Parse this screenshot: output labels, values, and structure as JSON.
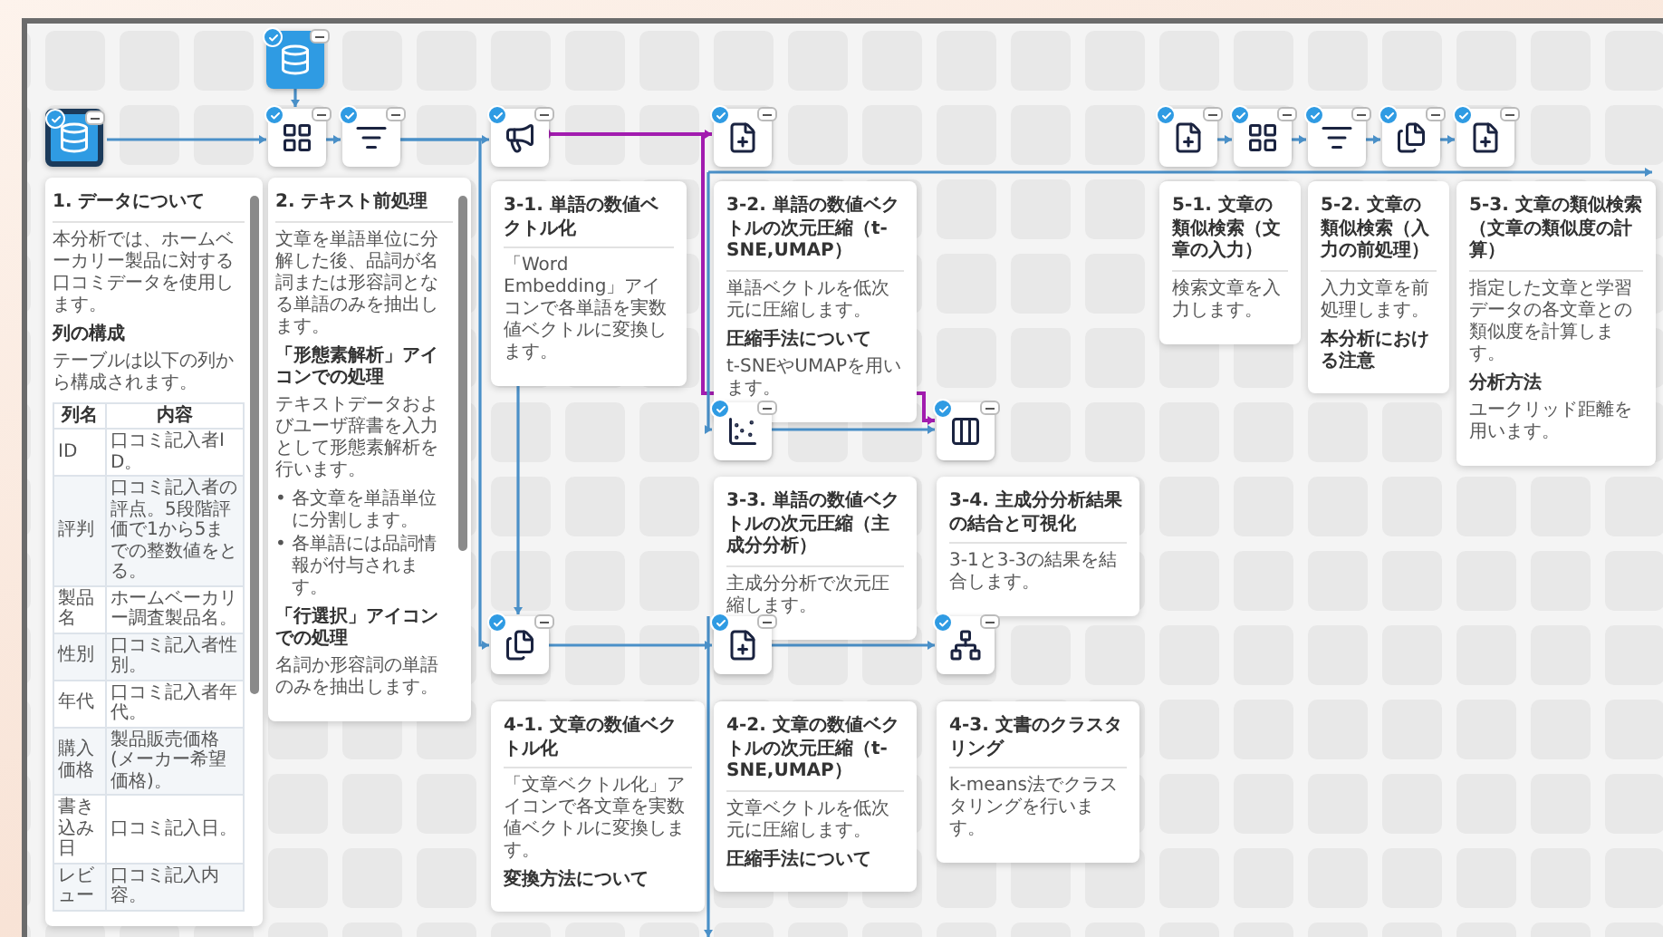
{
  "nodes": [
    {
      "kind": "database",
      "source": true,
      "selected": false,
      "checked": true
    },
    {
      "kind": "database",
      "source": true,
      "selected": true,
      "checked": true
    },
    {
      "kind": "grid",
      "source": false,
      "selected": false,
      "checked": true
    },
    {
      "kind": "filter",
      "source": false,
      "selected": false,
      "checked": true
    },
    {
      "kind": "speaker",
      "source": false,
      "selected": false,
      "checked": true
    },
    {
      "kind": "doc",
      "source": false,
      "selected": false,
      "checked": true
    },
    {
      "kind": "doc",
      "source": false,
      "selected": false,
      "checked": true
    },
    {
      "kind": "grid",
      "source": false,
      "selected": false,
      "checked": true
    },
    {
      "kind": "filter",
      "source": false,
      "selected": false,
      "checked": true
    },
    {
      "kind": "pages",
      "source": false,
      "selected": false,
      "checked": true
    },
    {
      "kind": "doc",
      "source": false,
      "selected": false,
      "checked": true
    },
    {
      "kind": "scatter",
      "source": false,
      "selected": false,
      "checked": true
    },
    {
      "kind": "columns",
      "source": false,
      "selected": false,
      "checked": true
    },
    {
      "kind": "pages",
      "source": false,
      "selected": false,
      "checked": true
    },
    {
      "kind": "doc",
      "source": false,
      "selected": false,
      "checked": true
    },
    {
      "kind": "network",
      "source": false,
      "selected": false,
      "checked": true
    }
  ],
  "edges": [
    {
      "selected": false
    },
    {
      "selected": false
    },
    {
      "selected": false
    },
    {
      "selected": false
    },
    {
      "selected": false
    },
    {
      "selected": true
    },
    {
      "selected": true
    },
    {
      "selected": false
    },
    {
      "selected": false
    },
    {
      "selected": false
    },
    {
      "selected": false
    },
    {
      "selected": false
    },
    {
      "selected": false
    },
    {
      "selected": false
    },
    {
      "selected": false
    },
    {
      "selected": false
    },
    {
      "selected": false
    },
    {
      "selected": false
    }
  ],
  "cards": [
    {
      "title": "1. データについて",
      "scrollable": true,
      "blocks": [
        {
          "kind": "p",
          "text": "本分析では、ホームベーカリー製品に対する口コミデータを使用します。"
        },
        {
          "kind": "h",
          "text": "列の構成"
        },
        {
          "kind": "p",
          "text": "テーブルは以下の列から構成されます。"
        },
        {
          "kind": "table",
          "columns": [
            "列名",
            "内容"
          ],
          "rows": [
            [
              "ID",
              "口コミ記入者ID。"
            ],
            [
              "評判",
              "口コミ記入者の評点。5段階評価で1から5までの整数値をとる。"
            ],
            [
              "製品名",
              "ホームベーカリー調査製品名。"
            ],
            [
              "性別",
              "口コミ記入者性別。"
            ],
            [
              "年代",
              "口コミ記入者年代。"
            ],
            [
              "購入価格",
              "製品販売価格(メーカー希望価格)。"
            ],
            [
              "書き込み日",
              "口コミ記入日。"
            ],
            [
              "レビュー",
              "口コミ記入内容。"
            ]
          ]
        }
      ]
    },
    {
      "title": "2. テキスト前処理",
      "scrollable": true,
      "blocks": [
        {
          "kind": "p",
          "text": "文章を単語単位に分解した後、品詞が名詞または形容詞となる単語のみを抽出します。"
        },
        {
          "kind": "h",
          "text": "「形態素解析」アイコンでの処理"
        },
        {
          "kind": "p",
          "text": "テキストデータおよびユーザ辞書を入力として形態素解析を行います。"
        },
        {
          "kind": "ul",
          "marker": "•",
          "items": [
            "各文章を単語単位に分割します。",
            "各単語には品詞情報が付与されます。"
          ]
        },
        {
          "kind": "h",
          "text": "「行選択」アイコンでの処理"
        },
        {
          "kind": "p",
          "text": "名詞か形容詞の単語のみを抽出します。"
        }
      ]
    },
    {
      "title": "3-1. 単語の数値ベクトル化",
      "scrollable": false,
      "blocks": [
        {
          "kind": "p",
          "text": "「Word Embedding」アイコンで各単語を実数値ベクトルに変換します。"
        }
      ]
    },
    {
      "title": "3-2. 単語の数値ベクトルの次元圧縮（t-SNE,UMAP）",
      "scrollable": false,
      "blocks": [
        {
          "kind": "p",
          "text": "単語ベクトルを低次元に圧縮します。"
        },
        {
          "kind": "h",
          "text": "圧縮手法について"
        },
        {
          "kind": "p",
          "text": "t-SNEやUMAPを用います。"
        }
      ]
    },
    {
      "title": "3-3. 単語の数値ベクトルの次元圧縮（主成分分析）",
      "scrollable": false,
      "blocks": [
        {
          "kind": "p",
          "text": "主成分分析で次元圧縮します。"
        }
      ]
    },
    {
      "title": "3-4. 主成分分析結果の結合と可視化",
      "scrollable": false,
      "blocks": [
        {
          "kind": "p",
          "text": "3-1と3-3の結果を結合します。"
        }
      ]
    },
    {
      "title": "4-1. 文章の数値ベクトル化",
      "scrollable": false,
      "blocks": [
        {
          "kind": "p",
          "text": "「文章ベクトル化」アイコンで各文章を実数値ベクトルに変換します。"
        },
        {
          "kind": "h",
          "text": "変換方法について"
        }
      ]
    },
    {
      "title": "4-2. 文章の数値ベクトルの次元圧縮（t-SNE,UMAP）",
      "scrollable": false,
      "blocks": [
        {
          "kind": "p",
          "text": "文章ベクトルを低次元に圧縮します。"
        },
        {
          "kind": "h",
          "text": "圧縮手法について"
        }
      ]
    },
    {
      "title": "4-3. 文書のクラスタリング",
      "scrollable": false,
      "blocks": [
        {
          "kind": "p",
          "text": "k-means法でクラスタリングを行います。"
        }
      ]
    },
    {
      "title": "5-1. 文章の類似検索（文章の入力）",
      "scrollable": false,
      "blocks": [
        {
          "kind": "p",
          "text": "検索文章を入力します。"
        }
      ]
    },
    {
      "title": "5-2. 文章の類似検索（入力の前処理）",
      "scrollable": false,
      "blocks": [
        {
          "kind": "p",
          "text": "入力文章を前処理します。"
        },
        {
          "kind": "h",
          "text": "本分析における注意"
        }
      ]
    },
    {
      "title": "5-3. 文章の類似検索（文章の類似度の計算）",
      "scrollable": false,
      "blocks": [
        {
          "kind": "p",
          "text": "指定した文章と学習データの各文章との類似度を計算します。"
        },
        {
          "kind": "h",
          "text": "分析方法"
        },
        {
          "kind": "p",
          "text": "ユークリッド距離を用います。"
        }
      ]
    }
  ]
}
